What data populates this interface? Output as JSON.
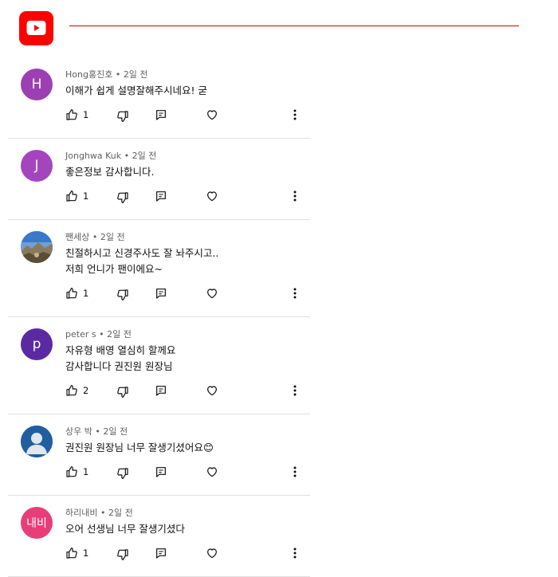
{
  "colors": {
    "brand": "#ff0000",
    "meta_text": "#606060",
    "divider": "#e0e0e0"
  },
  "header": {
    "logo_icon": "youtube-play-icon"
  },
  "comments": [
    {
      "author": "Hong홍진호",
      "time": "2일 전",
      "lines": [
        "이해가 쉽게 설명잘해주시네요! 굳"
      ],
      "likes": "1",
      "avatar": {
        "type": "letter",
        "letter": "H",
        "color": "#9c3fb3"
      }
    },
    {
      "author": "Jonghwa Kuk",
      "time": "2일 전",
      "lines": [
        "좋은정보 감사합니다."
      ],
      "likes": "1",
      "avatar": {
        "type": "letter",
        "letter": "J",
        "color": "#a545be"
      }
    },
    {
      "author": "짼세상",
      "time": "2일 전",
      "lines": [
        "친절하시고 신경주사도 잘 놔주시고..",
        "저희 언니가 팬이에요~"
      ],
      "likes": "1",
      "avatar": {
        "type": "photo",
        "icon": "landscape-photo-avatar"
      }
    },
    {
      "author": "peter s",
      "time": "2일 전",
      "lines": [
        "자유형 배영 열심히 할께요",
        "감사합니다 권진원 원장님"
      ],
      "likes": "2",
      "avatar": {
        "type": "letter",
        "letter": "p",
        "color": "#5b2aa3"
      }
    },
    {
      "author": "상우 박",
      "time": "2일 전",
      "lines": [
        "권진원 원장님 너무 잘생기셨어요😊"
      ],
      "likes": "1",
      "avatar": {
        "type": "default",
        "icon": "default-user-icon",
        "color": "#1f5fa0"
      }
    },
    {
      "author": "하리내비",
      "time": "2일 전",
      "lines": [
        "오어 선생님 너무 잘생기셨다"
      ],
      "likes": "1",
      "avatar": {
        "type": "letter",
        "letter": "내비",
        "color": "#e83e78"
      }
    }
  ]
}
